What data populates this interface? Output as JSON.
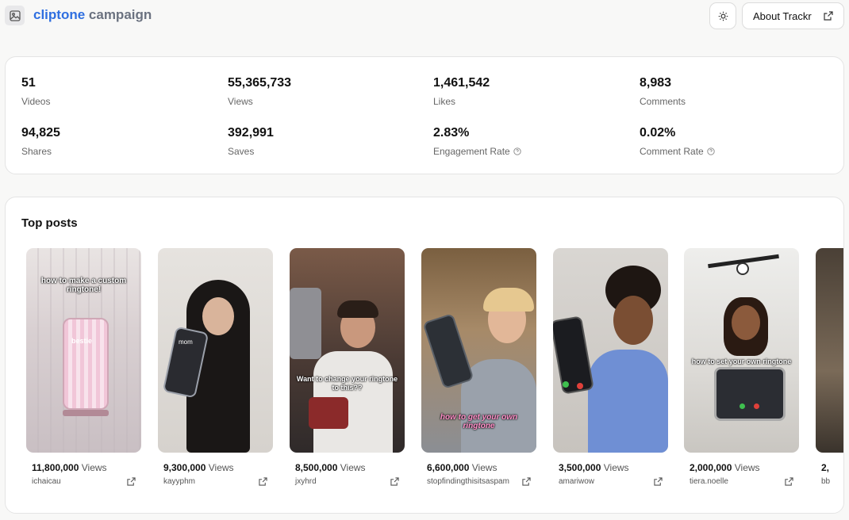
{
  "header": {
    "brand": "cliptone",
    "title_rest": "campaign",
    "about_label": "About Trackr"
  },
  "stats": [
    {
      "value": "51",
      "label": "Videos"
    },
    {
      "value": "55,365,733",
      "label": "Views"
    },
    {
      "value": "1,461,542",
      "label": "Likes"
    },
    {
      "value": "8,983",
      "label": "Comments"
    },
    {
      "value": "94,825",
      "label": "Shares"
    },
    {
      "value": "392,991",
      "label": "Saves"
    },
    {
      "value": "2.83%",
      "label": "Engagement Rate",
      "info": true
    },
    {
      "value": "0.02%",
      "label": "Comment Rate",
      "info": true
    }
  ],
  "top_posts": {
    "title": "Top posts",
    "views_unit": "Views",
    "posts": [
      {
        "views": "11,800,000",
        "user": "ichaicau",
        "caption": "how to make a custom ringtone!",
        "screen_text": "bestie"
      },
      {
        "views": "9,300,000",
        "user": "kayyphm",
        "caption": "",
        "screen_text": "mom"
      },
      {
        "views": "8,500,000",
        "user": "jxyhrd",
        "caption": "Want to change your ringtone to this??"
      },
      {
        "views": "6,600,000",
        "user": "stopfindingthisitsaspam",
        "caption": "how to get your own ringtone"
      },
      {
        "views": "3,500,000",
        "user": "amariwow",
        "caption": ""
      },
      {
        "views": "2,000,000",
        "user": "tiera.noelle",
        "caption": "how to set your own ringtone"
      },
      {
        "views": "2,",
        "user": "bb",
        "caption": ""
      }
    ]
  },
  "colors": {
    "brand": "#2f6fe0",
    "title_muted": "#6b7280",
    "background": "#f8f8f7"
  },
  "icons": {
    "logo": "image-icon",
    "theme": "sun-icon",
    "external": "external-link-icon",
    "info": "info-circle-icon"
  }
}
